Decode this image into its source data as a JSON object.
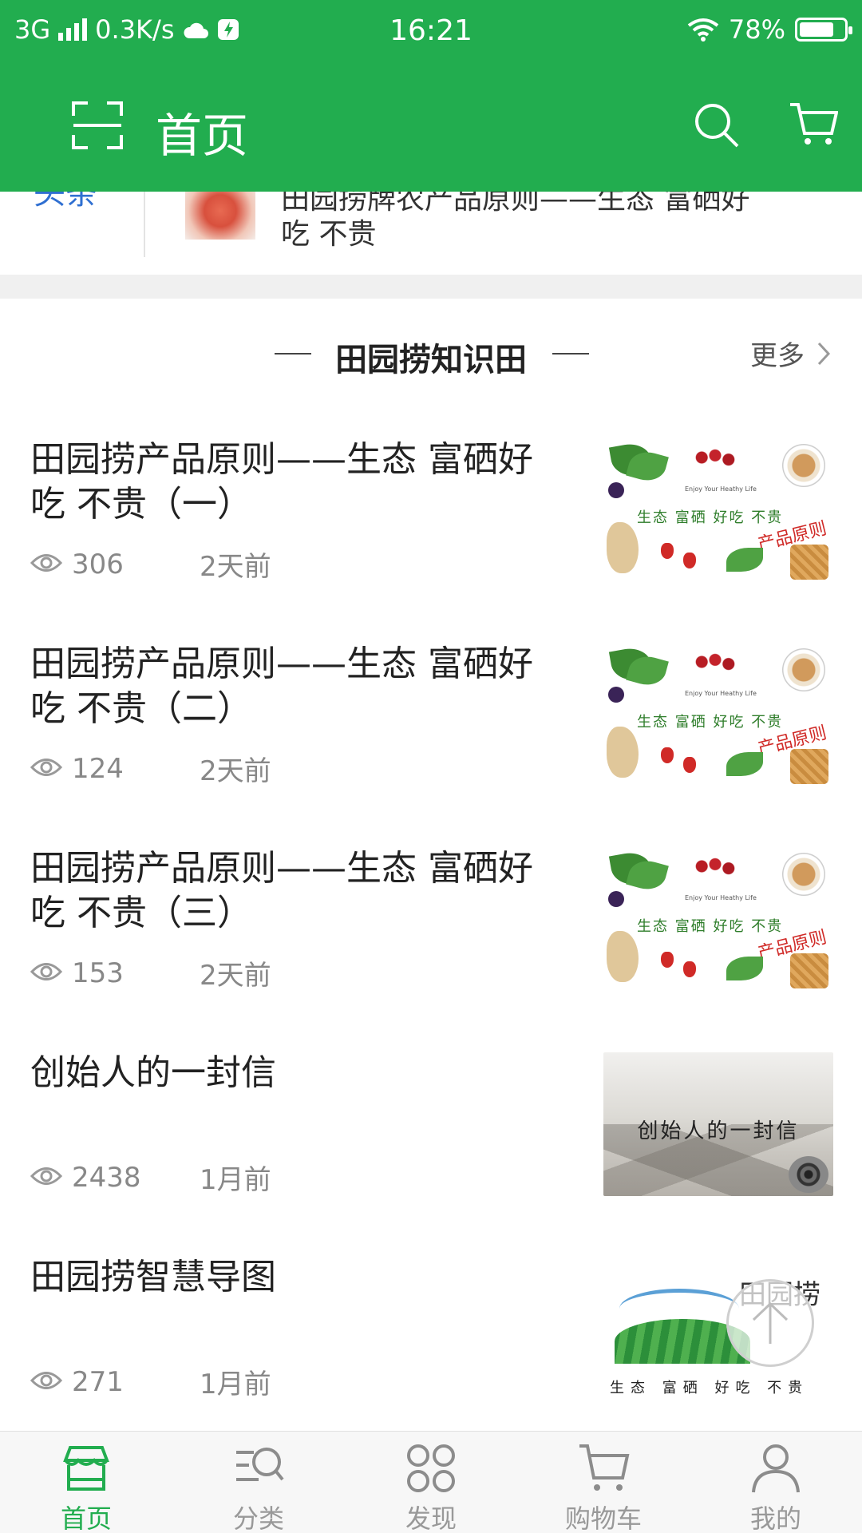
{
  "status_bar": {
    "network": "3G",
    "speed": "0.3K/s",
    "time": "16:21",
    "battery": "78%",
    "battery_level": 0.78
  },
  "header": {
    "title": "首页",
    "icons": [
      "scan-icon",
      "search-icon",
      "cart-icon"
    ]
  },
  "headline": {
    "tag": "头条",
    "text": "田园捞牌农产品原则——生态 富硒好吃 不贵"
  },
  "section": {
    "title": "田园捞知识田",
    "more": "更多"
  },
  "articles": [
    {
      "title": "田园捞产品原则——生态 富硒好吃 不贵（一）",
      "views": "306",
      "time": "2天前",
      "image": "produce",
      "img_small": "Enjoy Your Heathy Life",
      "img_words": "生态 富硒 好吃 不贵",
      "img_pp": "产品原则"
    },
    {
      "title": "田园捞产品原则——生态 富硒好吃 不贵（二）",
      "views": "124",
      "time": "2天前",
      "image": "produce",
      "img_small": "Enjoy Your Heathy Life",
      "img_words": "生态 富硒 好吃 不贵",
      "img_pp": "产品原则"
    },
    {
      "title": "田园捞产品原则——生态 富硒好吃 不贵（三）",
      "views": "153",
      "time": "2天前",
      "image": "produce",
      "img_small": "Enjoy Your Heathy Life",
      "img_words": "生态 富硒 好吃 不贵",
      "img_pp": "产品原则"
    },
    {
      "title": "创始人的一封信",
      "views": "2438",
      "time": "1月前",
      "image": "letter",
      "img_text": "创始人的一封信"
    },
    {
      "title": "田园捞智慧导图",
      "views": "271",
      "time": "1月前",
      "image": "logo",
      "img_brand": "田园捞",
      "img_slogan": "生态 富硒 好吃 不贵"
    }
  ],
  "bottom_nav": [
    {
      "label": "首页",
      "icon": "store-icon",
      "active": true
    },
    {
      "label": "分类",
      "icon": "category-search-icon",
      "active": false
    },
    {
      "label": "发现",
      "icon": "discover-icon",
      "active": false
    },
    {
      "label": "购物车",
      "icon": "cart-icon",
      "active": false
    },
    {
      "label": "我的",
      "icon": "user-icon",
      "active": false
    }
  ],
  "colors": {
    "brand_green": "#22ad4f",
    "link_blue": "#2f6fd1",
    "muted_gray": "#888888"
  }
}
